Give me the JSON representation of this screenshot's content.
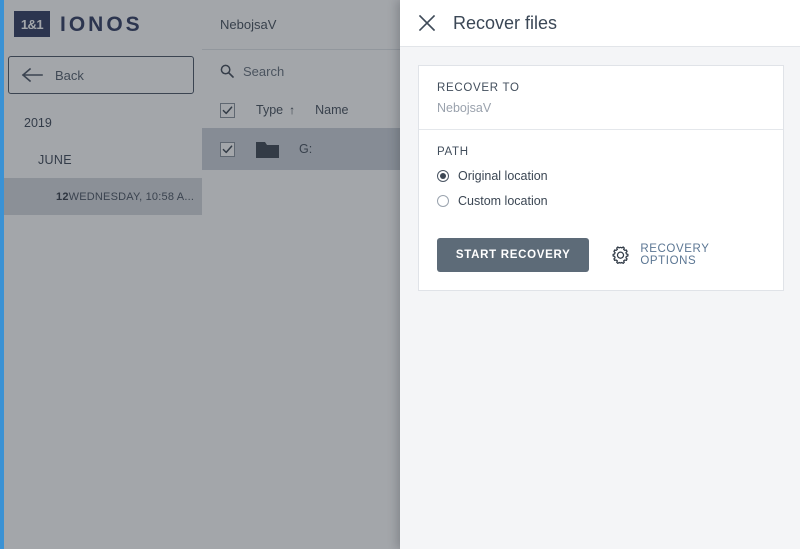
{
  "brand": {
    "mark": "1&1",
    "word": "IONOS"
  },
  "sidebar": {
    "back_label": "Back",
    "tree": [
      {
        "label": "2019",
        "level": "year",
        "selected": false
      },
      {
        "label": "JUNE",
        "level": "month",
        "selected": false
      },
      {
        "label_bold": "12",
        "label": " WEDNESDAY, 10:58 A...",
        "level": "snapshot",
        "selected": true
      }
    ]
  },
  "filelist": {
    "account": "NebojsaV",
    "search_placeholder": "Search",
    "columns": {
      "type": "Type",
      "sort_indicator": "↑",
      "name": "Name"
    },
    "rows": [
      {
        "name": "G:",
        "type": "folder",
        "checked": true,
        "selected": true
      }
    ]
  },
  "panel": {
    "title": "Recover files",
    "close_icon": "close-icon",
    "recover_to": {
      "label": "RECOVER TO",
      "value": "NebojsaV"
    },
    "path": {
      "label": "PATH",
      "options": [
        {
          "label": "Original location",
          "selected": true
        },
        {
          "label": "Custom location",
          "selected": false
        }
      ]
    },
    "actions": {
      "start_label": "START RECOVERY",
      "options_label": "RECOVERY OPTIONS",
      "options_icon": "gear-icon"
    }
  },
  "colors": {
    "accent_stripe": "#3b92d4",
    "brand_navy": "#1f2b54",
    "primary_button": "#5d6b78",
    "link": "#5b7693",
    "panel_bg": "#f4f5f7"
  }
}
